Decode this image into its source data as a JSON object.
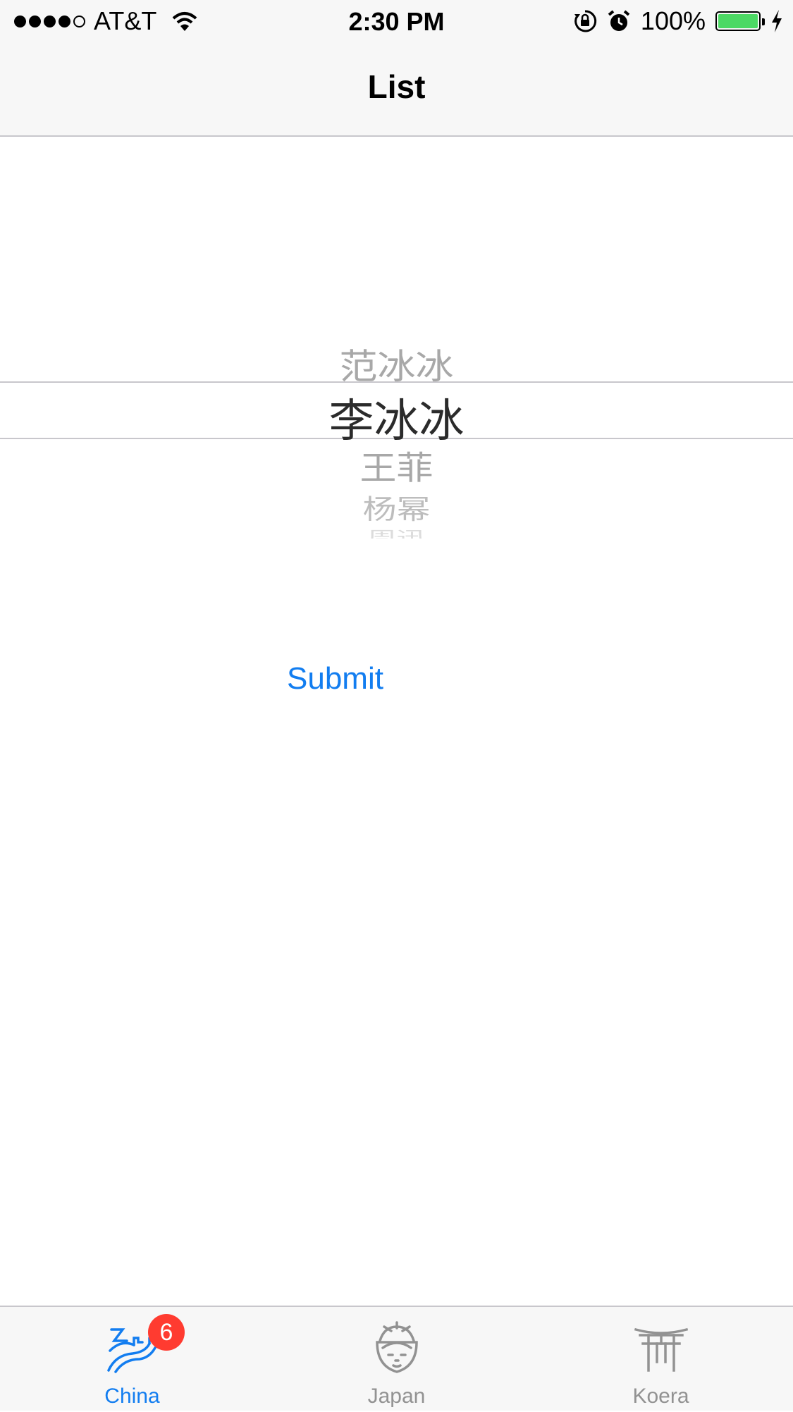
{
  "status_bar": {
    "carrier": "AT&T",
    "time": "2:30 PM",
    "battery_percent": "100%",
    "battery_level": 1.0,
    "icons": [
      "signal-dots",
      "wifi-icon",
      "rotation-lock-icon",
      "alarm-icon",
      "battery-icon",
      "charging-bolt-icon"
    ]
  },
  "nav": {
    "title": "List"
  },
  "picker": {
    "items": [
      "范冰冰",
      "李冰冰",
      "王菲",
      "杨幂",
      "周迅"
    ],
    "selected": "李冰冰"
  },
  "submit": {
    "label": "Submit"
  },
  "tabs": [
    {
      "label": "China",
      "icon": "great-wall-icon",
      "badge": "6",
      "active": true
    },
    {
      "label": "Japan",
      "icon": "geisha-icon",
      "active": false
    },
    {
      "label": "Koera",
      "icon": "torii-gate-icon",
      "active": false
    }
  ],
  "colors": {
    "accent": "#127df0",
    "badge": "#ff3b30",
    "battery": "#4cd964",
    "inactive": "#929292"
  }
}
